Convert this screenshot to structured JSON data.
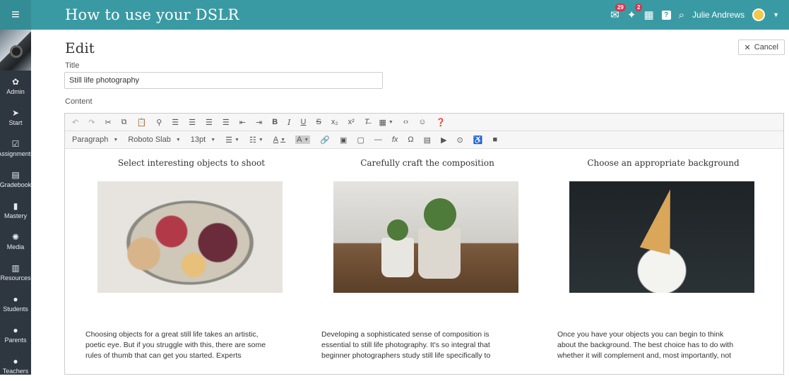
{
  "topbar": {
    "menu_icon": "hamburger-icon",
    "title": "How to use your DSLR",
    "badges": {
      "messages": "29",
      "notifications": "2"
    },
    "user_name": "Julie Andrews"
  },
  "sidebar": {
    "items": [
      {
        "label": "Admin",
        "icon": "gear-icon"
      },
      {
        "label": "Start",
        "icon": "arrow-icon"
      },
      {
        "label": "Assignments",
        "icon": "check-icon"
      },
      {
        "label": "Gradebook",
        "icon": "book-icon"
      },
      {
        "label": "Mastery",
        "icon": "bars-icon"
      },
      {
        "label": "Media",
        "icon": "sparkle-icon"
      },
      {
        "label": "Resources",
        "icon": "columns-icon"
      },
      {
        "label": "Students",
        "icon": "person-icon"
      },
      {
        "label": "Parents",
        "icon": "person-icon"
      },
      {
        "label": "Teachers",
        "icon": "person-icon"
      }
    ]
  },
  "page": {
    "heading": "Edit",
    "cancel_label": "Cancel",
    "title_label": "Title",
    "title_value": "Still life photography",
    "content_label": "Content"
  },
  "toolbar": {
    "format_select": "Paragraph",
    "font_select": "Roboto Slab",
    "size_select": "13pt"
  },
  "columns": [
    {
      "heading": "Select interesting objects to shoot",
      "text": "Choosing objects for a great still life takes an artistic, poetic eye. But if you struggle with this, there are some rules of thumb that can get you started. Experts"
    },
    {
      "heading": "Carefully craft the composition",
      "text": "Developing a sophisticated sense of composition is essential to still life photography. It's so integral that beginner photographers study still life specifically to"
    },
    {
      "heading": "Choose an appropriate background",
      "text": "Once you have your objects you can begin to think about the background. The best choice has to do with whether it will complement and, most importantly, not"
    }
  ],
  "colors": {
    "topbar": "#3a9aa3",
    "sidebar": "#2e3640",
    "badge": "#d9334e"
  }
}
